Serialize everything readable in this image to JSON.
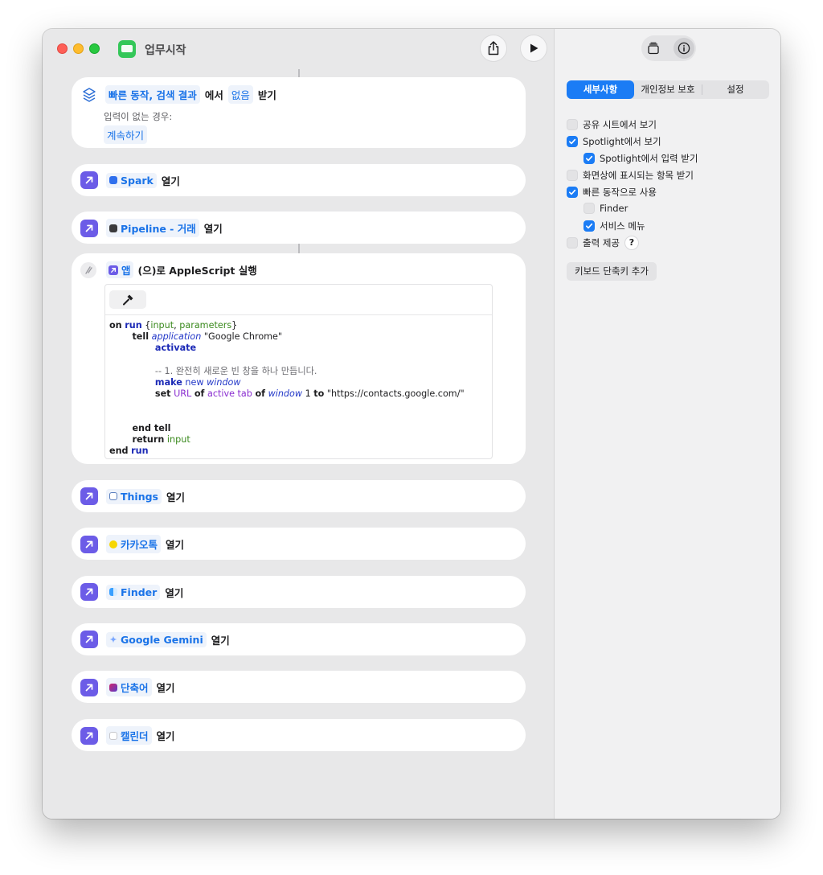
{
  "window": {
    "title": "업무시작"
  },
  "toolbar": {
    "share_icon": "share-icon",
    "run_icon": "play-icon"
  },
  "sidebar_toggle": {
    "library_icon": "library-icon",
    "info_icon": "info-icon"
  },
  "receive_card": {
    "prefix": "빠른 동작, 검색 결과",
    "from": "에서",
    "value": "없음",
    "verb": "받기",
    "no_input_label": "입력이 없는 경우:",
    "no_input_action": "계속하기"
  },
  "script_card": {
    "app_chip": "앱",
    "label": "(으)로 AppleScript 실행"
  },
  "code": {
    "l1_on": "on",
    "l1_run": "run",
    "l1_open": "{",
    "l1_input": "input",
    "l1_sep": ", ",
    "l1_params": "parameters",
    "l1_close": "}",
    "l2_tell": "tell",
    "l2_app": "application",
    "l2_str": "\"Google Chrome\"",
    "l3_activate": "activate",
    "l5_comment": "-- 1. 완전히 새로운 빈 창을 하나 만듭니다.",
    "l6_make": "make",
    "l6_new": "new",
    "l6_window": "window",
    "l7_set": "set",
    "l7_url": "URL",
    "l7_of1": "of",
    "l7_active": "active tab",
    "l7_of2": "of",
    "l7_window": "window",
    "l7_one": "1",
    "l7_to": "to",
    "l7_str": "\"https://contacts.google.com/\"",
    "l10_end": "end tell",
    "l11_return": "return",
    "l11_input": "input",
    "l12_end": "end",
    "l12_run": "run"
  },
  "open_actions": [
    {
      "app": "Spark",
      "verb": "열기",
      "icon_color": "#2f6fed"
    },
    {
      "app": "Pipeline - 거래",
      "verb": "열기",
      "icon_color": "#3a3a3c"
    },
    {
      "app": "Things",
      "verb": "열기",
      "icon_color": "#5a7fbf"
    },
    {
      "app": "카카오톡",
      "verb": "열기",
      "icon_color": "#f7d600"
    },
    {
      "app": "Finder",
      "verb": "열기",
      "icon_color": "#3aa0ff"
    },
    {
      "app": "Google Gemini",
      "verb": "열기",
      "icon_color": "#7aa7ff"
    },
    {
      "app": "단축어",
      "verb": "열기",
      "icon_color": "#d0256d"
    },
    {
      "app": "캘린더",
      "verb": "열기",
      "icon_color": "#c7c7cc"
    }
  ],
  "details": {
    "tabs": [
      "세부사항",
      "개인정보 보호",
      "설정"
    ],
    "active_tab": "세부사항",
    "options": {
      "share_sheet": "공유 시트에서 보기",
      "spotlight": "Spotlight에서 보기",
      "spotlight_input": "Spotlight에서 입력 받기",
      "onscreen": "화면상에 표시되는 항목 받기",
      "quick_action": "빠른 동작으로 사용",
      "finder": "Finder",
      "services": "서비스 메뉴",
      "output": "출력 제공",
      "help": "?"
    },
    "add_shortcut": "키보드 단축키 추가"
  },
  "colors": {
    "accent": "#1b7cf5",
    "action_purple": "#6c5ce7",
    "chip_text": "#1a73e8"
  }
}
